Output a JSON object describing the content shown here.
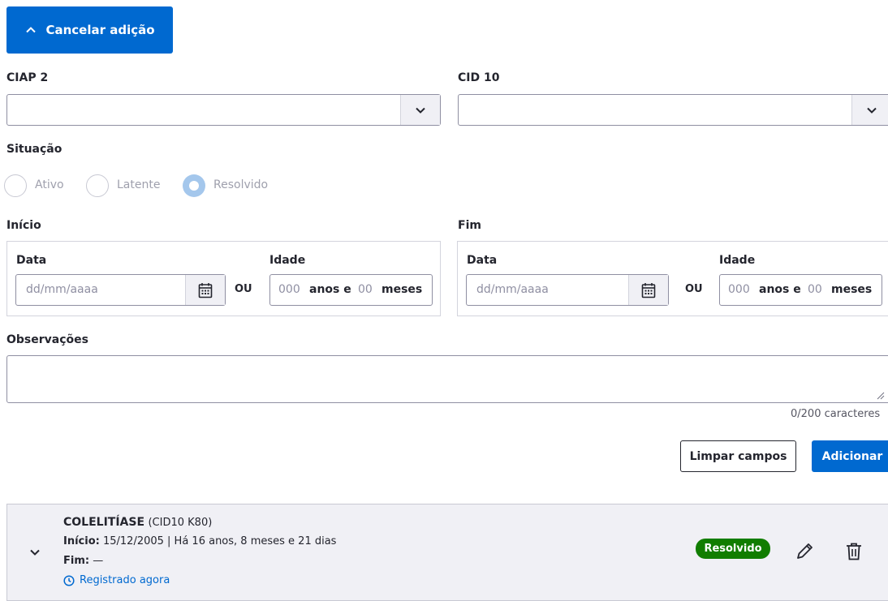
{
  "cancel_button": {
    "label": "Cancelar adição",
    "icon": "chevron-up-icon"
  },
  "ciap": {
    "label": "CIAP 2",
    "value": ""
  },
  "cid": {
    "label": "CID 10",
    "value": ""
  },
  "situacao": {
    "label": "Situação",
    "options": [
      "Ativo",
      "Latente",
      "Resolvido"
    ],
    "selected": "Resolvido"
  },
  "inicio": {
    "label": "Início",
    "data_label": "Data",
    "date_placeholder": "dd/mm/aaaa",
    "or_text": "OU",
    "idade_label": "Idade",
    "years_placeholder": "000",
    "years_unit": "anos e",
    "months_placeholder": "00",
    "months_unit": "meses"
  },
  "fim": {
    "label": "Fim",
    "data_label": "Data",
    "date_placeholder": "dd/mm/aaaa",
    "or_text": "OU",
    "idade_label": "Idade",
    "years_placeholder": "000",
    "years_unit": "anos e",
    "months_placeholder": "00",
    "months_unit": "meses"
  },
  "observacoes": {
    "label": "Observações",
    "value": "",
    "counter": "0/200 caracteres"
  },
  "actions": {
    "clear_label": "Limpar campos",
    "add_label": "Adicionar"
  },
  "problem_item": {
    "title": "COLELITÍASE",
    "code": "(CID10 K80)",
    "start_label": "Início:",
    "start_value": "15/12/2005 | Há 16 anos, 8 meses e 21 dias",
    "end_label": "Fim:",
    "end_value": "—",
    "registered": "Registrado agora",
    "status_badge": "Resolvido"
  },
  "colors": {
    "primary": "#0069d0",
    "success": "#117d00",
    "radio_selected": "#a4c7ec"
  }
}
